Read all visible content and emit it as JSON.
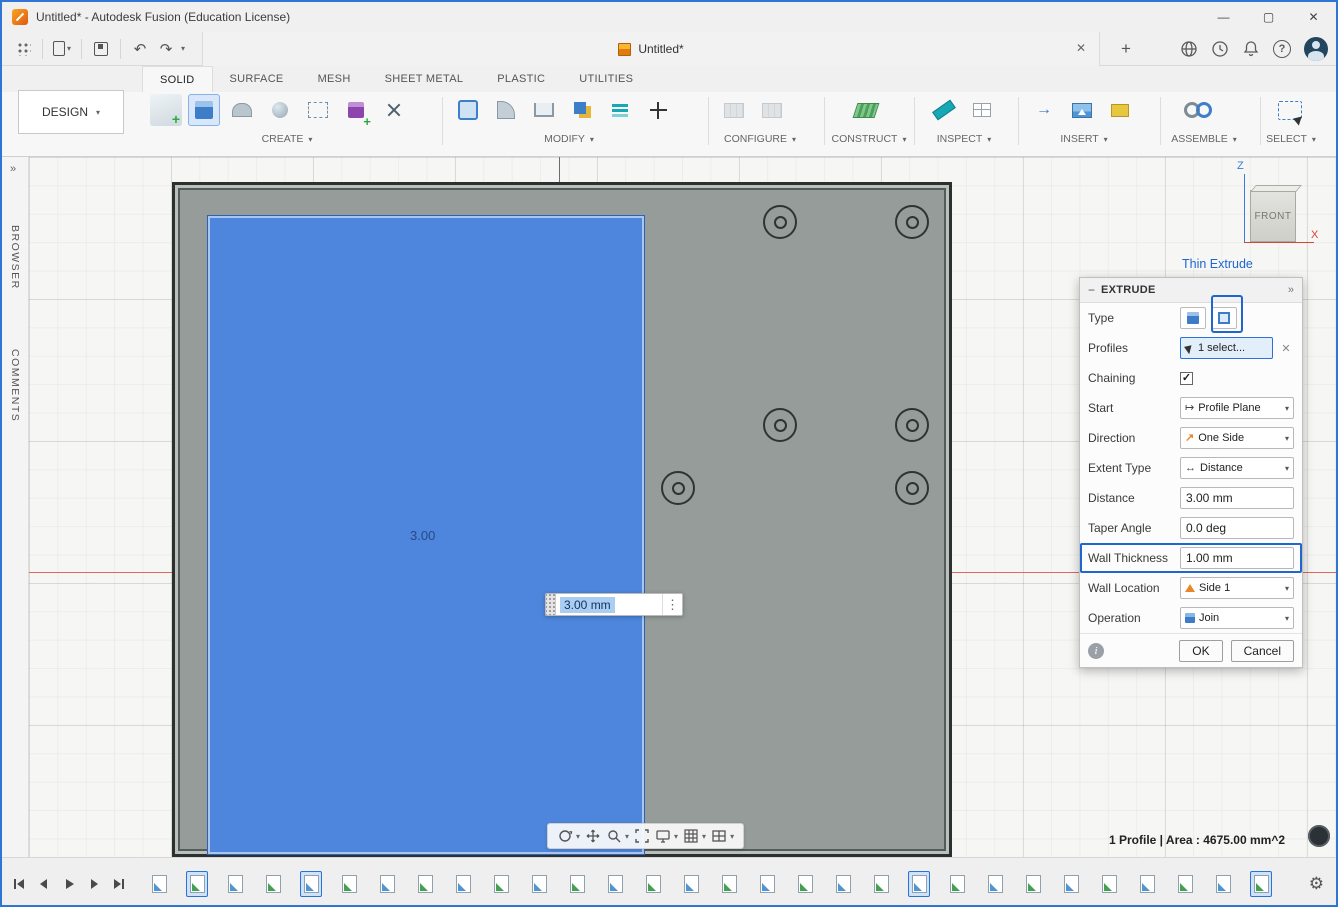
{
  "window": {
    "title": "Untitled* - Autodesk Fusion (Education License)"
  },
  "doc_tab": {
    "label": "Untitled*"
  },
  "icons": {
    "caret": "▾",
    "chevrons": "»",
    "minus": "−",
    "close": "✕",
    "plus": "+",
    "kebab": "⋮",
    "gear": "⚙",
    "undo": "↶",
    "redo": "↷",
    "check": "✓",
    "info": "i",
    "minimize": "—",
    "maximize": "▢",
    "question": "?",
    "arrow_ne": "↗",
    "arrow_lr": "↔",
    "map_to": "↦",
    "insert_arrow": "→"
  },
  "ribbon": {
    "workspace": "DESIGN",
    "tabs": [
      "SOLID",
      "SURFACE",
      "MESH",
      "SHEET METAL",
      "PLASTIC",
      "UTILITIES"
    ],
    "groups": [
      {
        "label": "CREATE"
      },
      {
        "label": "MODIFY"
      },
      {
        "label": "CONFIGURE"
      },
      {
        "label": "CONSTRUCT"
      },
      {
        "label": "INSPECT"
      },
      {
        "label": "INSERT"
      },
      {
        "label": "ASSEMBLE"
      },
      {
        "label": "SELECT"
      }
    ]
  },
  "rail": {
    "browser": "BROWSER",
    "comments": "COMMENTS"
  },
  "viewcube": {
    "face": "FRONT",
    "z": "Z",
    "x": "X"
  },
  "annotation": {
    "label": "Thin Extrude"
  },
  "canvas": {
    "dimension_label": "3.00",
    "dimension_input_value": "3.00 mm",
    "status": "1 Profile | Area : 4675.00 mm^2"
  },
  "dialog": {
    "title": "EXTRUDE",
    "rows": [
      {
        "label": "Type"
      },
      {
        "label": "Profiles",
        "value": "1 select..."
      },
      {
        "label": "Chaining"
      },
      {
        "label": "Start",
        "value": "Profile Plane"
      },
      {
        "label": "Direction",
        "value": "One Side"
      },
      {
        "label": "Extent Type",
        "value": "Distance"
      },
      {
        "label": "Distance",
        "value": "3.00 mm"
      },
      {
        "label": "Taper Angle",
        "value": "0.0 deg"
      },
      {
        "label": "Wall Thickness",
        "value": "1.00 mm"
      },
      {
        "label": "Wall Location",
        "value": "Side 1"
      },
      {
        "label": "Operation",
        "value": "Join"
      }
    ],
    "ok": "OK",
    "cancel": "Cancel"
  },
  "timeline": {
    "count": 30,
    "active_indices": [
      1,
      4,
      20,
      29
    ]
  },
  "colors": {
    "accent": "#1f66d1",
    "selection_face": "#4d86dc",
    "axis_x": "#d6453a"
  }
}
